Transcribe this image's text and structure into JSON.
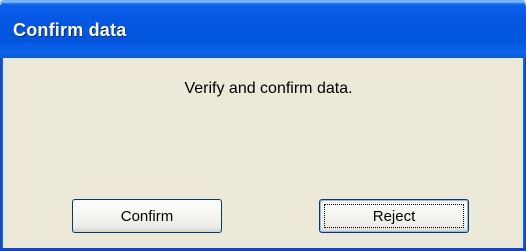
{
  "window": {
    "title": "Confirm data"
  },
  "dialog": {
    "message": "Verify and confirm data."
  },
  "buttons": {
    "confirm_label": "Confirm",
    "reject_label": "Reject"
  },
  "colors": {
    "titlebar_blue": "#0457e3",
    "client_background": "#ece9d8",
    "button_border": "#003c74"
  }
}
